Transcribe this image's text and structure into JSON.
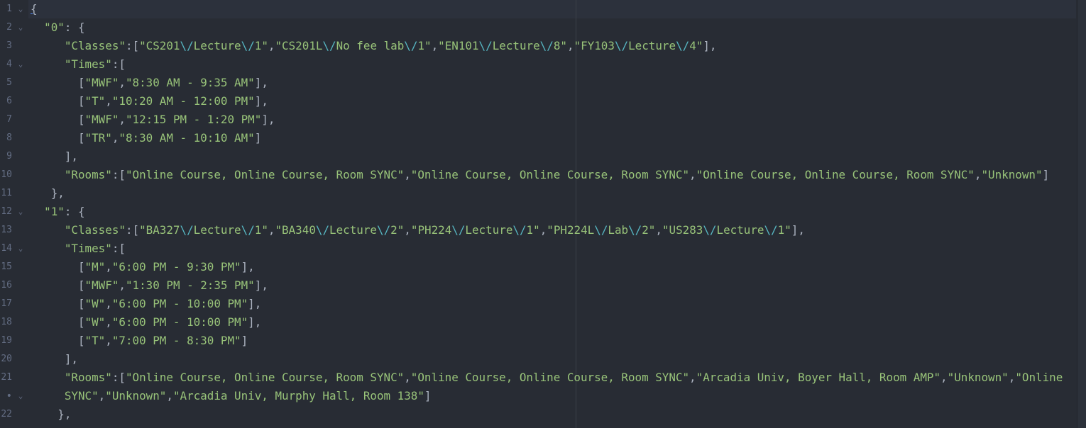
{
  "editor": {
    "line_numbers": [
      "1",
      "2",
      "3",
      "4",
      "5",
      "6",
      "7",
      "8",
      "9",
      "10",
      "11",
      "12",
      "13",
      "14",
      "15",
      "16",
      "17",
      "18",
      "19",
      "20",
      "21",
      "•",
      "22"
    ],
    "fold_markers": {
      "1": "⌄",
      "2": "⌄",
      "4": "⌄",
      "12": "⌄",
      "14": "⌄",
      "•": "⌄"
    },
    "lines": [
      [
        {
          "c": "brace-u",
          "t": "{"
        }
      ],
      [
        {
          "c": "p",
          "t": "  "
        },
        {
          "c": "s",
          "t": "\"0\""
        },
        {
          "c": "p",
          "t": ": {"
        }
      ],
      [
        {
          "c": "p",
          "t": "     "
        },
        {
          "c": "s",
          "t": "\"Classes\""
        },
        {
          "c": "p",
          "t": ":["
        },
        {
          "c": "s",
          "t": "\"CS201"
        },
        {
          "c": "e",
          "t": "\\/"
        },
        {
          "c": "s",
          "t": "Lecture"
        },
        {
          "c": "e",
          "t": "\\/"
        },
        {
          "c": "s",
          "t": "1\""
        },
        {
          "c": "p",
          "t": ","
        },
        {
          "c": "s",
          "t": "\"CS201L"
        },
        {
          "c": "e",
          "t": "\\/"
        },
        {
          "c": "s",
          "t": "No fee lab"
        },
        {
          "c": "e",
          "t": "\\/"
        },
        {
          "c": "s",
          "t": "1\""
        },
        {
          "c": "p",
          "t": ","
        },
        {
          "c": "s",
          "t": "\"EN101"
        },
        {
          "c": "e",
          "t": "\\/"
        },
        {
          "c": "s",
          "t": "Lecture"
        },
        {
          "c": "e",
          "t": "\\/"
        },
        {
          "c": "s",
          "t": "8\""
        },
        {
          "c": "p",
          "t": ","
        },
        {
          "c": "s",
          "t": "\"FY103"
        },
        {
          "c": "e",
          "t": "\\/"
        },
        {
          "c": "s",
          "t": "Lecture"
        },
        {
          "c": "e",
          "t": "\\/"
        },
        {
          "c": "s",
          "t": "4\""
        },
        {
          "c": "p",
          "t": "],"
        }
      ],
      [
        {
          "c": "p",
          "t": "     "
        },
        {
          "c": "s",
          "t": "\"Times\""
        },
        {
          "c": "p",
          "t": ":["
        }
      ],
      [
        {
          "c": "p",
          "t": "       ["
        },
        {
          "c": "s",
          "t": "\"MWF\""
        },
        {
          "c": "p",
          "t": ","
        },
        {
          "c": "s",
          "t": "\"8:30 AM - 9:35 AM\""
        },
        {
          "c": "p",
          "t": "],"
        }
      ],
      [
        {
          "c": "p",
          "t": "       ["
        },
        {
          "c": "s",
          "t": "\"T\""
        },
        {
          "c": "p",
          "t": ","
        },
        {
          "c": "s",
          "t": "\"10:20 AM - 12:00 PM\""
        },
        {
          "c": "p",
          "t": "],"
        }
      ],
      [
        {
          "c": "p",
          "t": "       ["
        },
        {
          "c": "s",
          "t": "\"MWF\""
        },
        {
          "c": "p",
          "t": ","
        },
        {
          "c": "s",
          "t": "\"12:15 PM - 1:20 PM\""
        },
        {
          "c": "p",
          "t": "],"
        }
      ],
      [
        {
          "c": "p",
          "t": "       ["
        },
        {
          "c": "s",
          "t": "\"TR\""
        },
        {
          "c": "p",
          "t": ","
        },
        {
          "c": "s",
          "t": "\"8:30 AM - 10:10 AM\""
        },
        {
          "c": "p",
          "t": "]"
        }
      ],
      [
        {
          "c": "p",
          "t": "     ],"
        }
      ],
      [
        {
          "c": "p",
          "t": "     "
        },
        {
          "c": "s",
          "t": "\"Rooms\""
        },
        {
          "c": "p",
          "t": ":["
        },
        {
          "c": "s",
          "t": "\"Online Course, Online Course, Room SYNC\""
        },
        {
          "c": "p",
          "t": ","
        },
        {
          "c": "s",
          "t": "\"Online Course, Online Course, Room SYNC\""
        },
        {
          "c": "p",
          "t": ","
        },
        {
          "c": "s",
          "t": "\"Online Course, Online Course, Room SYNC\""
        },
        {
          "c": "p",
          "t": ","
        },
        {
          "c": "s",
          "t": "\"Unknown\""
        },
        {
          "c": "p",
          "t": "]"
        }
      ],
      [
        {
          "c": "p",
          "t": "   },"
        }
      ],
      [
        {
          "c": "p",
          "t": "  "
        },
        {
          "c": "s",
          "t": "\"1\""
        },
        {
          "c": "p",
          "t": ": {"
        }
      ],
      [
        {
          "c": "p",
          "t": "     "
        },
        {
          "c": "s",
          "t": "\"Classes\""
        },
        {
          "c": "p",
          "t": ":["
        },
        {
          "c": "s",
          "t": "\"BA327"
        },
        {
          "c": "e",
          "t": "\\/"
        },
        {
          "c": "s",
          "t": "Lecture"
        },
        {
          "c": "e",
          "t": "\\/"
        },
        {
          "c": "s",
          "t": "1\""
        },
        {
          "c": "p",
          "t": ","
        },
        {
          "c": "s",
          "t": "\"BA340"
        },
        {
          "c": "e",
          "t": "\\/"
        },
        {
          "c": "s",
          "t": "Lecture"
        },
        {
          "c": "e",
          "t": "\\/"
        },
        {
          "c": "s",
          "t": "2\""
        },
        {
          "c": "p",
          "t": ","
        },
        {
          "c": "s",
          "t": "\"PH224"
        },
        {
          "c": "e",
          "t": "\\/"
        },
        {
          "c": "s",
          "t": "Lecture"
        },
        {
          "c": "e",
          "t": "\\/"
        },
        {
          "c": "s",
          "t": "1\""
        },
        {
          "c": "p",
          "t": ","
        },
        {
          "c": "s",
          "t": "\"PH224L"
        },
        {
          "c": "e",
          "t": "\\/"
        },
        {
          "c": "s",
          "t": "Lab"
        },
        {
          "c": "e",
          "t": "\\/"
        },
        {
          "c": "s",
          "t": "2\""
        },
        {
          "c": "p",
          "t": ","
        },
        {
          "c": "s",
          "t": "\"US283"
        },
        {
          "c": "e",
          "t": "\\/"
        },
        {
          "c": "s",
          "t": "Lecture"
        },
        {
          "c": "e",
          "t": "\\/"
        },
        {
          "c": "s",
          "t": "1\""
        },
        {
          "c": "p",
          "t": "],"
        }
      ],
      [
        {
          "c": "p",
          "t": "     "
        },
        {
          "c": "s",
          "t": "\"Times\""
        },
        {
          "c": "p",
          "t": ":["
        }
      ],
      [
        {
          "c": "p",
          "t": "       ["
        },
        {
          "c": "s",
          "t": "\"M\""
        },
        {
          "c": "p",
          "t": ","
        },
        {
          "c": "s",
          "t": "\"6:00 PM - 9:30 PM\""
        },
        {
          "c": "p",
          "t": "],"
        }
      ],
      [
        {
          "c": "p",
          "t": "       ["
        },
        {
          "c": "s",
          "t": "\"MWF\""
        },
        {
          "c": "p",
          "t": ","
        },
        {
          "c": "s",
          "t": "\"1:30 PM - 2:35 PM\""
        },
        {
          "c": "p",
          "t": "],"
        }
      ],
      [
        {
          "c": "p",
          "t": "       ["
        },
        {
          "c": "s",
          "t": "\"W\""
        },
        {
          "c": "p",
          "t": ","
        },
        {
          "c": "s",
          "t": "\"6:00 PM - 10:00 PM\""
        },
        {
          "c": "p",
          "t": "],"
        }
      ],
      [
        {
          "c": "p",
          "t": "       ["
        },
        {
          "c": "s",
          "t": "\"W\""
        },
        {
          "c": "p",
          "t": ","
        },
        {
          "c": "s",
          "t": "\"6:00 PM - 10:00 PM\""
        },
        {
          "c": "p",
          "t": "],"
        }
      ],
      [
        {
          "c": "p",
          "t": "       ["
        },
        {
          "c": "s",
          "t": "\"T\""
        },
        {
          "c": "p",
          "t": ","
        },
        {
          "c": "s",
          "t": "\"7:00 PM - 8:30 PM\""
        },
        {
          "c": "p",
          "t": "]"
        }
      ],
      [
        {
          "c": "p",
          "t": "     ],"
        }
      ],
      [
        {
          "c": "p",
          "t": "     "
        },
        {
          "c": "s",
          "t": "\"Rooms\""
        },
        {
          "c": "p",
          "t": ":["
        },
        {
          "c": "s",
          "t": "\"Online Course, Online Course, Room SYNC\""
        },
        {
          "c": "p",
          "t": ","
        },
        {
          "c": "s",
          "t": "\"Online Course, Online Course, Room SYNC\""
        },
        {
          "c": "p",
          "t": ","
        },
        {
          "c": "s",
          "t": "\"Arcadia Univ, Boyer Hall, Room AMP\""
        },
        {
          "c": "p",
          "t": ","
        },
        {
          "c": "s",
          "t": "\"Unknown\""
        },
        {
          "c": "p",
          "t": ","
        },
        {
          "c": "s",
          "t": "\"Online"
        }
      ],
      [
        {
          "c": "s",
          "t": "     SYNC\""
        },
        {
          "c": "p",
          "t": ","
        },
        {
          "c": "s",
          "t": "\"Unknown\""
        },
        {
          "c": "p",
          "t": ","
        },
        {
          "c": "s",
          "t": "\"Arcadia Univ, Murphy Hall, Room 138\""
        },
        {
          "c": "p",
          "t": "]"
        }
      ],
      [
        {
          "c": "p",
          "t": "    },"
        }
      ]
    ]
  }
}
